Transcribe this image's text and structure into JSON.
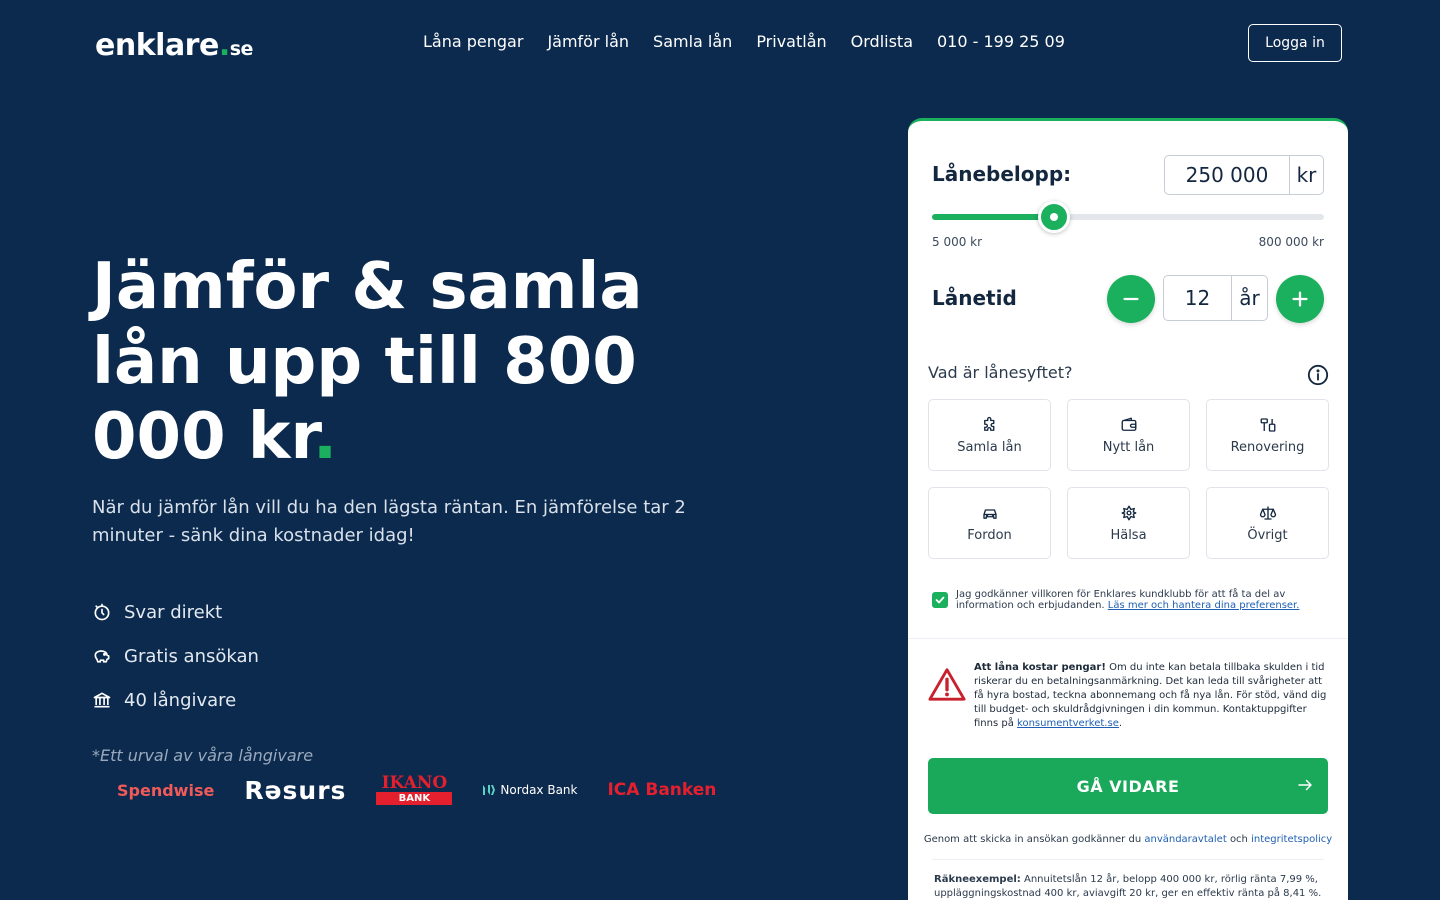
{
  "header": {
    "logo_main": "enklare",
    "logo_dot": ".",
    "logo_tld": "se",
    "nav": [
      "Låna pengar",
      "Jämför lån",
      "Samla lån",
      "Privatlån",
      "Ordlista",
      "010 - 199 25 09"
    ],
    "login_label": "Logga in"
  },
  "hero": {
    "title": "Jämför & samla lån upp till 800 000 kr",
    "title_dot": ".",
    "subtitle": "När du jämför lån vill du ha den lägsta räntan. En jämförelse tar 2 minuter - sänk dina kostnader idag!",
    "features": [
      {
        "icon": "stopwatch-icon",
        "label": "Svar direkt"
      },
      {
        "icon": "piggy-bank-icon",
        "label": "Gratis ansökan"
      },
      {
        "icon": "bank-icon",
        "label": "40 långivare"
      }
    ],
    "lenders_note": "*Ett urval av våra långivare",
    "lenders": {
      "spendwise": "Spendwise",
      "resurs": "Rəsurs",
      "ikano_top": "IKANO",
      "ikano_bottom": "BANK",
      "nordax": "Nordax Bank",
      "ica": "ICA Banken"
    }
  },
  "calculator": {
    "amount_label": "Lånebelopp:",
    "amount_value": "250 000",
    "amount_unit": "kr",
    "amount_fraction": 0.31,
    "range_min": "5 000 kr",
    "range_max": "800 000 kr",
    "term_label": "Lånetid",
    "term_value": "12",
    "term_unit": "år",
    "purpose_question": "Vad är lånesyftet?",
    "purposes": [
      {
        "icon": "puzzle-icon",
        "label": "Samla lån"
      },
      {
        "icon": "wallet-icon",
        "label": "Nytt lån"
      },
      {
        "icon": "tools-icon",
        "label": "Renovering"
      },
      {
        "icon": "car-icon",
        "label": "Fordon"
      },
      {
        "icon": "health-icon",
        "label": "Hälsa"
      },
      {
        "icon": "scale-icon",
        "label": "Övrigt"
      }
    ],
    "consent_text": "Jag godkänner villkoren för Enklares kundklubb för att få ta del av information och erbjudanden.",
    "consent_link": "Läs mer och hantera dina preferenser.",
    "warning_bold": "Att låna kostar pengar!",
    "warning_text": "Om du inte kan betala tillbaka skulden i tid riskerar du en betalningsanmärkning. Det kan leda till svårigheter att få hyra bostad, teckna abonnemang och få nya lån. För stöd, vänd dig till budget- och skuldrådgivningen i din kommun. Kontaktuppgifter finns på",
    "warning_link": "konsumentverket.se",
    "warning_end": ".",
    "cta_label": "GÅ VIDARE",
    "terms_prefix": "Genom att skicka in ansökan godkänner du",
    "terms_link1": "användaravtalet",
    "terms_mid": "och",
    "terms_link2": "integritetspolicy",
    "example_bold": "Räkneexempel:",
    "example_text": "Annuitetslån 12 år, belopp 400 000 kr, rörlig ränta 7,99 %, uppläggningskostnad 400 kr, aviavgift 20 kr, ger en effektiv ränta på 8,41 %."
  },
  "colors": {
    "background": "#0c2a4d",
    "accent": "#1bb05d",
    "link": "#1e5fb3",
    "warning": "#c8202c"
  }
}
